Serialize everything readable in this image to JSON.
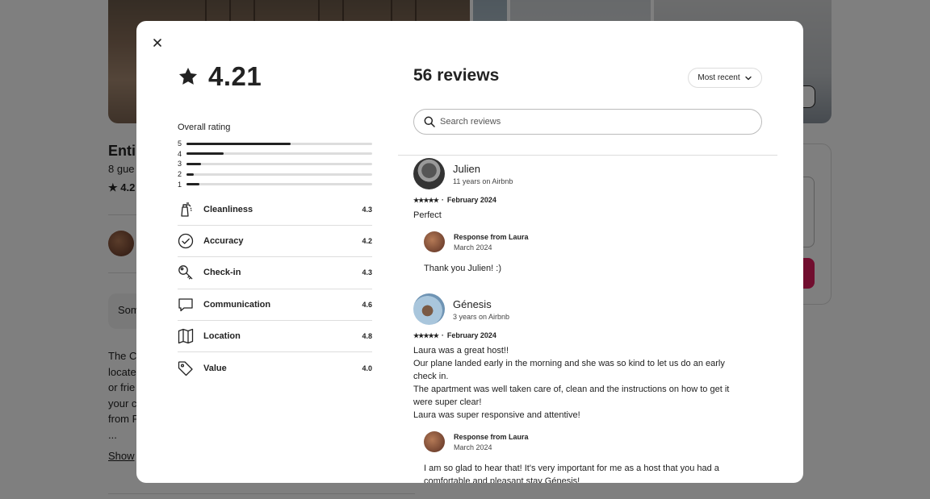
{
  "background": {
    "title_fragment": "Entir",
    "subtitle_fragment": "8 gue",
    "rating_fragment": "4.2",
    "box_text": "Som",
    "description_lines": [
      "The C",
      "locate",
      "or frie",
      "your c",
      "from F",
      "..."
    ],
    "show_more": "Show"
  },
  "modal": {
    "rating": "4.21",
    "overall_label": "Overall rating",
    "histogram": [
      {
        "label": "5",
        "fraction": 0.56
      },
      {
        "label": "4",
        "fraction": 0.2
      },
      {
        "label": "3",
        "fraction": 0.08
      },
      {
        "label": "2",
        "fraction": 0.04
      },
      {
        "label": "1",
        "fraction": 0.07
      }
    ],
    "categories": [
      {
        "name": "Cleanliness",
        "score": "4.3",
        "icon": "spray-bottle-icon"
      },
      {
        "name": "Accuracy",
        "score": "4.2",
        "icon": "check-circle-icon"
      },
      {
        "name": "Check-in",
        "score": "4.3",
        "icon": "key-icon"
      },
      {
        "name": "Communication",
        "score": "4.6",
        "icon": "chat-bubble-icon"
      },
      {
        "name": "Location",
        "score": "4.8",
        "icon": "map-icon"
      },
      {
        "name": "Value",
        "score": "4.0",
        "icon": "tag-icon"
      }
    ],
    "reviews_title": "56 reviews",
    "sort_label": "Most recent",
    "search_placeholder": "Search reviews",
    "reviews": [
      {
        "name": "Julien",
        "tenure": "11 years on Airbnb",
        "stars": "★★★★★",
        "date": "February 2024",
        "text": [
          "Perfect"
        ],
        "response_title": "Response from Laura",
        "response_date": "March 2024",
        "response_text": [
          "Thank you Julien! :)"
        ]
      },
      {
        "name": "Génesis",
        "tenure": "3 years on Airbnb",
        "stars": "★★★★★",
        "date": "February 2024",
        "text": [
          "Laura was a great host!!",
          "Our plane landed early in the morning and she was so kind to let us do an early",
          "check in.",
          "The apartment was well taken care of, clean and the instructions on how to get it",
          "were super clear!",
          "Laura was super responsive and attentive!"
        ],
        "response_title": "Response from Laura",
        "response_date": "March 2024",
        "response_text": [
          "I am so glad to hear that! It's very important for me as a host that you had a",
          "comfortable and pleasant stay Génesis!"
        ]
      }
    ]
  }
}
